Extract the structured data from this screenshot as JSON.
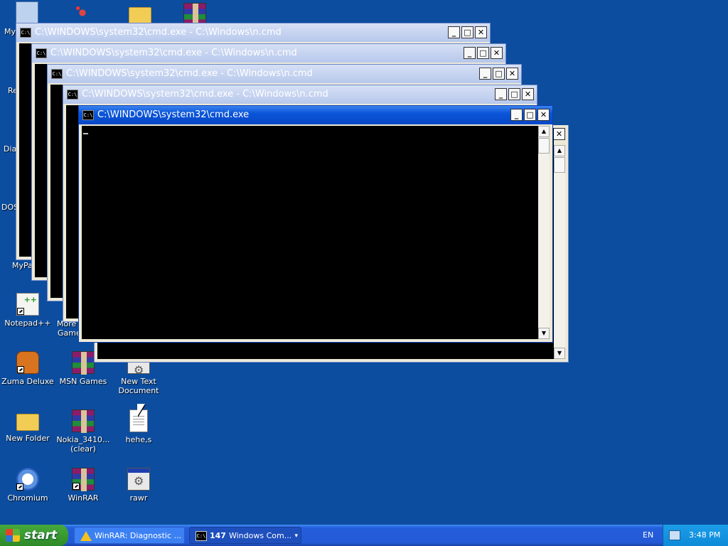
{
  "desktop": {
    "icons": {
      "notepadpp": "Notepad++",
      "zuma": "Zuma Deluxe",
      "msn_games": "MSN Games",
      "new_text": "New Text Document",
      "new_folder": "New Folder",
      "nokia": "Nokia_3410... (clear)",
      "hehe": "hehe,s",
      "chromium": "Chromium",
      "winrar": "WinRAR",
      "rawr": "rawr"
    },
    "partial_labels": {
      "my": "My",
      "re": "Re",
      "dia": "Dia",
      "dos": "DOS",
      "mypa": "MyPa",
      "more": "More",
      "game": "Game"
    }
  },
  "windows": {
    "cmd1_title": "C:\\WINDOWS\\system32\\cmd.exe - C:\\Windows\\n.cmd",
    "cmd2_title": "C:\\WINDOWS\\system32\\cmd.exe - C:\\Windows\\n.cmd",
    "cmd3_title": "C:\\WINDOWS\\system32\\cmd.exe - C:\\Windows\\n.cmd",
    "cmd4_title": "C:\\WINDOWS\\system32\\cmd.exe - C:\\Windows\\n.cmd",
    "active_title": "C:\\WINDOWS\\system32\\cmd.exe",
    "icon_text": "C:\\",
    "btn_min": "_",
    "btn_max": "□",
    "btn_close": "✕"
  },
  "taskbar": {
    "start_label": "start",
    "task1_label": "WinRAR: Diagnostic ...",
    "task2_count": "147",
    "task2_label": "Windows Com...",
    "task2_drop": "▾",
    "language": "EN",
    "clock": "3:48 PM"
  }
}
